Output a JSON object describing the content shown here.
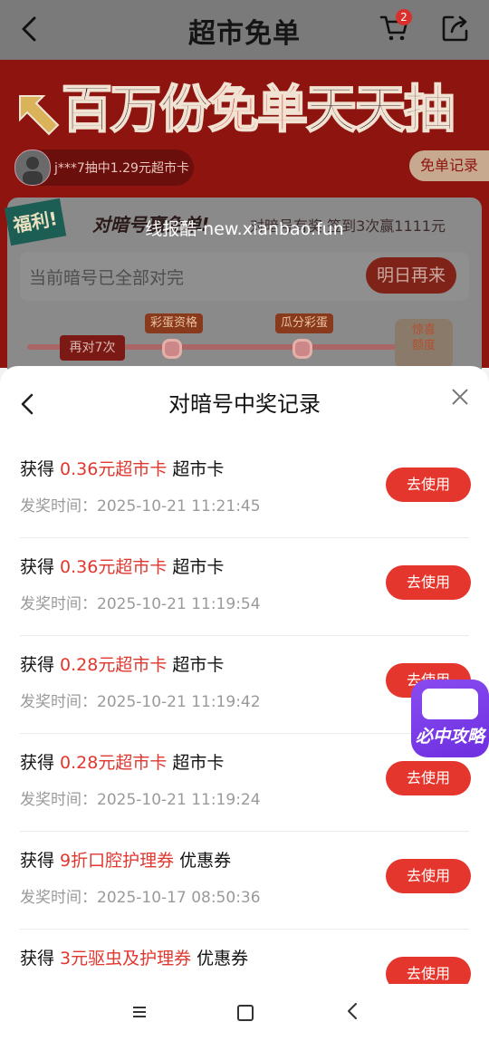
{
  "topbar": {
    "title": "超市免单",
    "cart_badge": "2"
  },
  "hero": {
    "headline_part1": "百万份",
    "headline_highlight": "免单",
    "headline_part2": "天天抽",
    "winner_text": "j***7抽中1.29元超市卡",
    "record_button": "免单记录",
    "badge": "福利!",
    "card_title": "对暗号赢免单!",
    "card_subtitle": "对暗号有奖 签到3次赢1111元",
    "watermark": "线报酷-new.xianbao.fun",
    "code_status": "当前暗号已全部对完",
    "tomorrow_button": "明日再来",
    "again_chip": "再对7次",
    "tag1": "彩蛋资格",
    "tag2": "瓜分彩蛋",
    "surprise": "惊喜\n额度"
  },
  "sheet": {
    "title": "对暗号中奖记录",
    "records": [
      {
        "prefix": "获得",
        "prize": "0.36元超市卡",
        "type": "超市卡",
        "time_label": "发奖时间：",
        "time": "2025-10-21 11:21:45",
        "button": "去使用"
      },
      {
        "prefix": "获得",
        "prize": "0.36元超市卡",
        "type": "超市卡",
        "time_label": "发奖时间：",
        "time": "2025-10-21 11:19:54",
        "button": "去使用"
      },
      {
        "prefix": "获得",
        "prize": "0.28元超市卡",
        "type": "超市卡",
        "time_label": "发奖时间：",
        "time": "2025-10-21 11:19:42",
        "button": "去使用"
      },
      {
        "prefix": "获得",
        "prize": "0.28元超市卡",
        "type": "超市卡",
        "time_label": "发奖时间：",
        "time": "2025-10-21 11:19:24",
        "button": "去使用"
      },
      {
        "prefix": "获得",
        "prize": "9折口腔护理券",
        "type": "优惠券",
        "time_label": "发奖时间：",
        "time": "2025-10-17 08:50:36",
        "button": "去使用"
      },
      {
        "prefix": "获得",
        "prize": "3元驱虫及护理券",
        "type": "优惠券",
        "time_label": "",
        "time": "",
        "button": "去使用"
      }
    ]
  },
  "floating_tip": {
    "label": "必中攻略"
  },
  "colors": {
    "accent_red": "#e5362e",
    "prize_red": "#e0372f",
    "tip_purple": "#7b3cea"
  }
}
